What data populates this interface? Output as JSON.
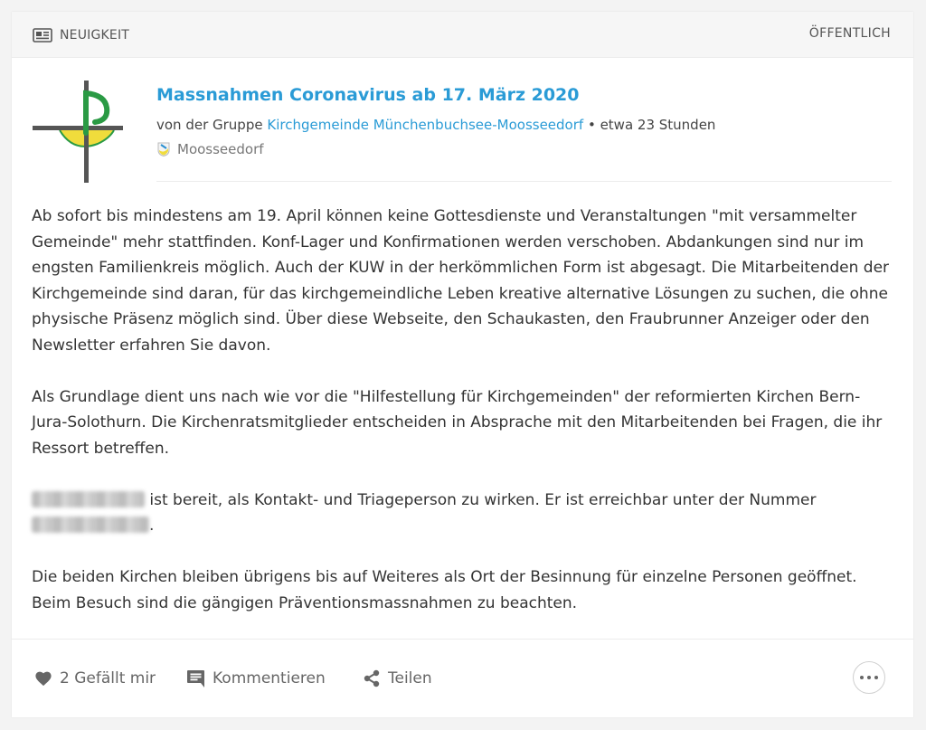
{
  "header": {
    "type_label": "NEUIGKEIT",
    "visibility": "ÖFFENTLICH"
  },
  "post": {
    "title": "Massnahmen Coronavirus ab 17. März 2020",
    "meta_prefix": "von der Gruppe ",
    "group_name": "Kirchgemeinde Münchenbuchsee-Moosseedorf",
    "meta_suffix": " • etwa 23 Stunden",
    "location": "Moosseedorf",
    "paragraphs": {
      "p1": "Ab sofort bis mindestens am 19. April können keine Gottesdienste und Veranstaltungen \"mit versammelter Gemeinde\" mehr stattfinden. Konf-Lager und Konfirmationen werden verschoben. Abdankungen sind nur im engsten Familienkreis möglich. Auch der KUW in der herkömmlichen Form ist abgesagt. Die Mitarbeitenden der Kirchgemeinde sind daran, für das kirchgemeindliche Leben kreative alternative Lösungen zu suchen, die ohne physische Präsenz möglich sind. Über diese Webseite, den Schaukasten, den Fraubrunner Anzeiger oder den Newsletter erfahren Sie davon.",
      "p2": "Als Grundlage dient uns nach wie vor die \"Hilfestellung für Kirchgemeinden\" der reformierten Kirchen Bern-Jura-Solothurn. Die Kirchenratsmitglieder entscheiden in Absprache mit den Mitarbeitenden bei Fragen, die ihr Ressort betreffen.",
      "p3_text": " ist bereit, als Kontakt- und Triageperson zu wirken. Er ist erreichbar unter der Nummer ",
      "p3_end": ".",
      "p4": "Die beiden Kirchen bleiben übrigens bis auf Weiteres als Ort der Besinnung für einzelne Personen geöffnet. Beim Besuch sind die gängigen Präventionsmassnahmen zu beachten."
    }
  },
  "actions": {
    "like": "2 Gefällt mir",
    "comment": "Kommentieren",
    "share": "Teilen"
  },
  "icons": {
    "type": "newspaper-icon",
    "like": "heart-icon",
    "comment": "comment-icon",
    "share": "share-icon",
    "more": "more-icon",
    "location": "crest-icon"
  },
  "colors": {
    "link": "#2a9bd6",
    "logo_green": "#2a9a44",
    "logo_yellow": "#f0dc3c"
  }
}
